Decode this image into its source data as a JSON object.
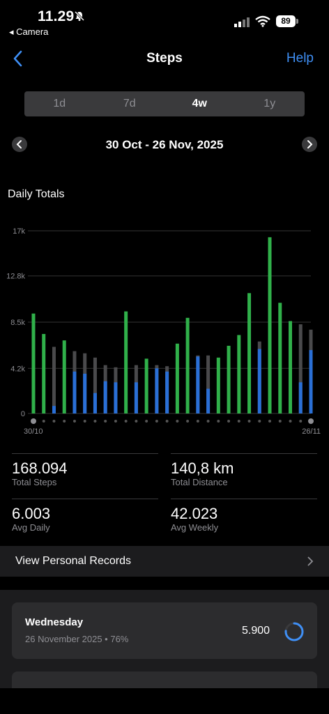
{
  "status": {
    "time": "11.29",
    "back_app": "◂ Camera",
    "battery": "89"
  },
  "nav": {
    "title": "Steps",
    "help": "Help"
  },
  "segments": [
    "1d",
    "7d",
    "4w",
    "1y"
  ],
  "selected_segment": "4w",
  "range": "30 Oct - 26 Nov, 2025",
  "section_title": "Daily Totals",
  "chart_data": {
    "type": "bar",
    "y_ticks": [
      "17k",
      "12.8k",
      "8.5k",
      "4.2k",
      "0"
    ],
    "y_tick_values": [
      17000,
      12800,
      8500,
      4200,
      0
    ],
    "ylim": [
      0,
      17000
    ],
    "x_start_label": "30/10",
    "x_end_label": "26/11",
    "colors": {
      "green": "#30b04a",
      "blue": "#2a6fd6",
      "gray": "#4a4a4c"
    },
    "series_note_values": "per day: total (bar height) with goal reached (green) or not; blue = portion",
    "days": [
      {
        "total": 9300,
        "blue": 0,
        "green": true
      },
      {
        "total": 7400,
        "blue": 0,
        "green": true
      },
      {
        "total": 6200,
        "blue": 700,
        "green": false
      },
      {
        "total": 6800,
        "blue": 0,
        "green": true
      },
      {
        "total": 5800,
        "blue": 3900,
        "green": false
      },
      {
        "total": 5600,
        "blue": 3700,
        "green": false
      },
      {
        "total": 5200,
        "blue": 1900,
        "green": false
      },
      {
        "total": 4500,
        "blue": 3000,
        "green": false
      },
      {
        "total": 4300,
        "blue": 2900,
        "green": false
      },
      {
        "total": 9500,
        "blue": 0,
        "green": true
      },
      {
        "total": 4500,
        "blue": 2900,
        "green": false
      },
      {
        "total": 5100,
        "blue": 0,
        "green": true
      },
      {
        "total": 4500,
        "blue": 4200,
        "green": false
      },
      {
        "total": 4400,
        "blue": 3900,
        "green": false
      },
      {
        "total": 6500,
        "blue": 0,
        "green": true
      },
      {
        "total": 8900,
        "blue": 0,
        "green": true
      },
      {
        "total": 5400,
        "blue": 5300,
        "green": false
      },
      {
        "total": 5400,
        "blue": 2300,
        "green": false
      },
      {
        "total": 5200,
        "blue": 0,
        "green": true
      },
      {
        "total": 6300,
        "blue": 0,
        "green": true
      },
      {
        "total": 7300,
        "blue": 0,
        "green": true
      },
      {
        "total": 11200,
        "blue": 0,
        "green": true
      },
      {
        "total": 6700,
        "blue": 6000,
        "green": false
      },
      {
        "total": 16400,
        "blue": 0,
        "green": true
      },
      {
        "total": 10300,
        "blue": 0,
        "green": true
      },
      {
        "total": 8600,
        "blue": 0,
        "green": true
      },
      {
        "total": 8300,
        "blue": 2900,
        "green": false
      },
      {
        "total": 7800,
        "blue": 5900,
        "green": false
      }
    ]
  },
  "stats": [
    {
      "value": "168.094",
      "label": "Total Steps"
    },
    {
      "value": "140,8 km",
      "label": "Total Distance"
    },
    {
      "value": "6.003",
      "label": "Avg Daily"
    },
    {
      "value": "42.023",
      "label": "Avg Weekly"
    }
  ],
  "records_label": "View Personal Records",
  "day_card": {
    "title": "Wednesday",
    "subtitle": "26 November 2025 • 76%",
    "value": "5.900",
    "progress": 0.76
  }
}
